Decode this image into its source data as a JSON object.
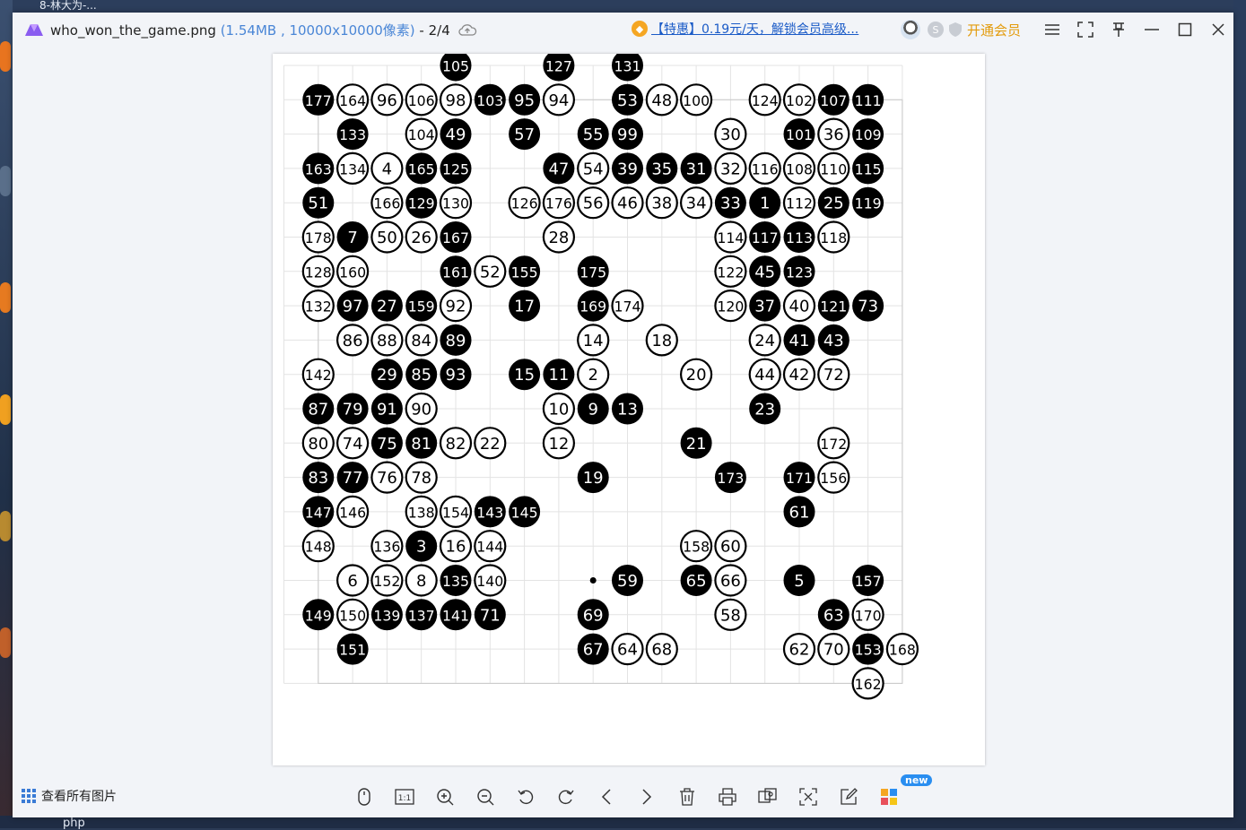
{
  "desktop": {
    "top_text": "8-林大为-...",
    "bottom_text": "php"
  },
  "window": {
    "file_name": "who_won_the_game.png",
    "file_meta": "(1.54MB , 10000x10000像素)",
    "page_index": "- 2/4",
    "promo_text": "【特惠】0.19元/天，解锁会员高级...",
    "vip_label": "开通会员",
    "icons": {
      "app": "app-logo-icon",
      "cloud": "cloud-upload-icon",
      "promo": "hexagon-badge-icon",
      "vip": "shield-icon"
    },
    "colors": {
      "link": "#4a86d6",
      "promo": "#1b5bc7",
      "vip": "#e39b0c",
      "accent_badge": "#2a8ef0"
    }
  },
  "toolbar": {
    "view_all_label": "查看所有图片",
    "new_badge": "new",
    "tools": [
      "mouse-icon",
      "actual-size-icon",
      "zoom-in-icon",
      "zoom-out-icon",
      "rotate-left-icon",
      "rotate-right-icon",
      "prev-icon",
      "next-icon",
      "delete-icon",
      "print-icon",
      "convert-icon",
      "ocr-icon",
      "edit-icon",
      "apps-icon"
    ],
    "actual_size_label": "1:1"
  },
  "board": {
    "size": 19,
    "colors": {
      "black": "#000000",
      "white": "#ffffff",
      "grid": "#e3e3e3"
    },
    "stones": [
      {
        "c": 5,
        "r": 0,
        "n": 105,
        "color": "black"
      },
      {
        "c": 8,
        "r": 0,
        "n": 127,
        "color": "black"
      },
      {
        "c": 10,
        "r": 0,
        "n": 131,
        "color": "black"
      },
      {
        "c": 1,
        "r": 1,
        "n": 177,
        "color": "black"
      },
      {
        "c": 2,
        "r": 1,
        "n": 164,
        "color": "white"
      },
      {
        "c": 3,
        "r": 1,
        "n": 96,
        "color": "white"
      },
      {
        "c": 4,
        "r": 1,
        "n": 106,
        "color": "white"
      },
      {
        "c": 5,
        "r": 1,
        "n": 98,
        "color": "white"
      },
      {
        "c": 6,
        "r": 1,
        "n": 103,
        "color": "black"
      },
      {
        "c": 7,
        "r": 1,
        "n": 95,
        "color": "black"
      },
      {
        "c": 8,
        "r": 1,
        "n": 94,
        "color": "white"
      },
      {
        "c": 10,
        "r": 1,
        "n": 53,
        "color": "black"
      },
      {
        "c": 11,
        "r": 1,
        "n": 48,
        "color": "white"
      },
      {
        "c": 12,
        "r": 1,
        "n": 100,
        "color": "white"
      },
      {
        "c": 14,
        "r": 1,
        "n": 124,
        "color": "white"
      },
      {
        "c": 15,
        "r": 1,
        "n": 102,
        "color": "white"
      },
      {
        "c": 16,
        "r": 1,
        "n": 107,
        "color": "black"
      },
      {
        "c": 17,
        "r": 1,
        "n": 111,
        "color": "black"
      },
      {
        "c": 2,
        "r": 2,
        "n": 133,
        "color": "black"
      },
      {
        "c": 4,
        "r": 2,
        "n": 104,
        "color": "white"
      },
      {
        "c": 5,
        "r": 2,
        "n": 49,
        "color": "black"
      },
      {
        "c": 7,
        "r": 2,
        "n": 57,
        "color": "black"
      },
      {
        "c": 9,
        "r": 2,
        "n": 55,
        "color": "black"
      },
      {
        "c": 10,
        "r": 2,
        "n": 99,
        "color": "black"
      },
      {
        "c": 13,
        "r": 2,
        "n": 30,
        "color": "white"
      },
      {
        "c": 15,
        "r": 2,
        "n": 101,
        "color": "black"
      },
      {
        "c": 16,
        "r": 2,
        "n": 36,
        "color": "white"
      },
      {
        "c": 17,
        "r": 2,
        "n": 109,
        "color": "black"
      },
      {
        "c": 1,
        "r": 3,
        "n": 163,
        "color": "black"
      },
      {
        "c": 2,
        "r": 3,
        "n": 134,
        "color": "white"
      },
      {
        "c": 3,
        "r": 3,
        "n": 4,
        "color": "white"
      },
      {
        "c": 4,
        "r": 3,
        "n": 165,
        "color": "black"
      },
      {
        "c": 5,
        "r": 3,
        "n": 125,
        "color": "black"
      },
      {
        "c": 8,
        "r": 3,
        "n": 47,
        "color": "black"
      },
      {
        "c": 9,
        "r": 3,
        "n": 54,
        "color": "white"
      },
      {
        "c": 10,
        "r": 3,
        "n": 39,
        "color": "black"
      },
      {
        "c": 11,
        "r": 3,
        "n": 35,
        "color": "black"
      },
      {
        "c": 12,
        "r": 3,
        "n": 31,
        "color": "black"
      },
      {
        "c": 13,
        "r": 3,
        "n": 32,
        "color": "white"
      },
      {
        "c": 14,
        "r": 3,
        "n": 116,
        "color": "white"
      },
      {
        "c": 15,
        "r": 3,
        "n": 108,
        "color": "white"
      },
      {
        "c": 16,
        "r": 3,
        "n": 110,
        "color": "white"
      },
      {
        "c": 17,
        "r": 3,
        "n": 115,
        "color": "black"
      },
      {
        "c": 1,
        "r": 4,
        "n": 51,
        "color": "black"
      },
      {
        "c": 3,
        "r": 4,
        "n": 166,
        "color": "white"
      },
      {
        "c": 4,
        "r": 4,
        "n": 129,
        "color": "black"
      },
      {
        "c": 5,
        "r": 4,
        "n": 130,
        "color": "white"
      },
      {
        "c": 7,
        "r": 4,
        "n": 126,
        "color": "white"
      },
      {
        "c": 8,
        "r": 4,
        "n": 176,
        "color": "white"
      },
      {
        "c": 9,
        "r": 4,
        "n": 56,
        "color": "white"
      },
      {
        "c": 10,
        "r": 4,
        "n": 46,
        "color": "white"
      },
      {
        "c": 11,
        "r": 4,
        "n": 38,
        "color": "white"
      },
      {
        "c": 12,
        "r": 4,
        "n": 34,
        "color": "white"
      },
      {
        "c": 13,
        "r": 4,
        "n": 33,
        "color": "black"
      },
      {
        "c": 14,
        "r": 4,
        "n": 1,
        "color": "black"
      },
      {
        "c": 15,
        "r": 4,
        "n": 112,
        "color": "white"
      },
      {
        "c": 16,
        "r": 4,
        "n": 25,
        "color": "black"
      },
      {
        "c": 17,
        "r": 4,
        "n": 119,
        "color": "black"
      },
      {
        "c": 1,
        "r": 5,
        "n": 178,
        "color": "white"
      },
      {
        "c": 2,
        "r": 5,
        "n": 7,
        "color": "black"
      },
      {
        "c": 3,
        "r": 5,
        "n": 50,
        "color": "white"
      },
      {
        "c": 4,
        "r": 5,
        "n": 26,
        "color": "white"
      },
      {
        "c": 5,
        "r": 5,
        "n": 167,
        "color": "black"
      },
      {
        "c": 8,
        "r": 5,
        "n": 28,
        "color": "white"
      },
      {
        "c": 13,
        "r": 5,
        "n": 114,
        "color": "white"
      },
      {
        "c": 14,
        "r": 5,
        "n": 117,
        "color": "black"
      },
      {
        "c": 15,
        "r": 5,
        "n": 113,
        "color": "black"
      },
      {
        "c": 16,
        "r": 5,
        "n": 118,
        "color": "white"
      },
      {
        "c": 1,
        "r": 6,
        "n": 128,
        "color": "white"
      },
      {
        "c": 2,
        "r": 6,
        "n": 160,
        "color": "white"
      },
      {
        "c": 5,
        "r": 6,
        "n": 161,
        "color": "black"
      },
      {
        "c": 6,
        "r": 6,
        "n": 52,
        "color": "white"
      },
      {
        "c": 7,
        "r": 6,
        "n": 155,
        "color": "black"
      },
      {
        "c": 9,
        "r": 6,
        "n": 175,
        "color": "black"
      },
      {
        "c": 13,
        "r": 6,
        "n": 122,
        "color": "white"
      },
      {
        "c": 14,
        "r": 6,
        "n": 45,
        "color": "black"
      },
      {
        "c": 15,
        "r": 6,
        "n": 123,
        "color": "black"
      },
      {
        "c": 1,
        "r": 7,
        "n": 132,
        "color": "white"
      },
      {
        "c": 2,
        "r": 7,
        "n": 97,
        "color": "black"
      },
      {
        "c": 3,
        "r": 7,
        "n": 27,
        "color": "black"
      },
      {
        "c": 4,
        "r": 7,
        "n": 159,
        "color": "black"
      },
      {
        "c": 5,
        "r": 7,
        "n": 92,
        "color": "white"
      },
      {
        "c": 7,
        "r": 7,
        "n": 17,
        "color": "black"
      },
      {
        "c": 9,
        "r": 7,
        "n": 169,
        "color": "black"
      },
      {
        "c": 10,
        "r": 7,
        "n": 174,
        "color": "white"
      },
      {
        "c": 13,
        "r": 7,
        "n": 120,
        "color": "white"
      },
      {
        "c": 14,
        "r": 7,
        "n": 37,
        "color": "black"
      },
      {
        "c": 15,
        "r": 7,
        "n": 40,
        "color": "white"
      },
      {
        "c": 16,
        "r": 7,
        "n": 121,
        "color": "black"
      },
      {
        "c": 17,
        "r": 7,
        "n": 73,
        "color": "black"
      },
      {
        "c": 2,
        "r": 8,
        "n": 86,
        "color": "white"
      },
      {
        "c": 3,
        "r": 8,
        "n": 88,
        "color": "white"
      },
      {
        "c": 4,
        "r": 8,
        "n": 84,
        "color": "white"
      },
      {
        "c": 5,
        "r": 8,
        "n": 89,
        "color": "black"
      },
      {
        "c": 9,
        "r": 8,
        "n": 14,
        "color": "white"
      },
      {
        "c": 11,
        "r": 8,
        "n": 18,
        "color": "white"
      },
      {
        "c": 14,
        "r": 8,
        "n": 24,
        "color": "white"
      },
      {
        "c": 15,
        "r": 8,
        "n": 41,
        "color": "black"
      },
      {
        "c": 16,
        "r": 8,
        "n": 43,
        "color": "black"
      },
      {
        "c": 1,
        "r": 9,
        "n": 142,
        "color": "white"
      },
      {
        "c": 3,
        "r": 9,
        "n": 29,
        "color": "black"
      },
      {
        "c": 4,
        "r": 9,
        "n": 85,
        "color": "black"
      },
      {
        "c": 5,
        "r": 9,
        "n": 93,
        "color": "black"
      },
      {
        "c": 7,
        "r": 9,
        "n": 15,
        "color": "black"
      },
      {
        "c": 8,
        "r": 9,
        "n": 11,
        "color": "black"
      },
      {
        "c": 9,
        "r": 9,
        "n": 2,
        "color": "white"
      },
      {
        "c": 12,
        "r": 9,
        "n": 20,
        "color": "white"
      },
      {
        "c": 14,
        "r": 9,
        "n": 44,
        "color": "white"
      },
      {
        "c": 15,
        "r": 9,
        "n": 42,
        "color": "white"
      },
      {
        "c": 16,
        "r": 9,
        "n": 72,
        "color": "white"
      },
      {
        "c": 1,
        "r": 10,
        "n": 87,
        "color": "black"
      },
      {
        "c": 2,
        "r": 10,
        "n": 79,
        "color": "black"
      },
      {
        "c": 3,
        "r": 10,
        "n": 91,
        "color": "black"
      },
      {
        "c": 4,
        "r": 10,
        "n": 90,
        "color": "white"
      },
      {
        "c": 8,
        "r": 10,
        "n": 10,
        "color": "white"
      },
      {
        "c": 9,
        "r": 10,
        "n": 9,
        "color": "black"
      },
      {
        "c": 10,
        "r": 10,
        "n": 13,
        "color": "black"
      },
      {
        "c": 14,
        "r": 10,
        "n": 23,
        "color": "black"
      },
      {
        "c": 1,
        "r": 11,
        "n": 80,
        "color": "white"
      },
      {
        "c": 2,
        "r": 11,
        "n": 74,
        "color": "white"
      },
      {
        "c": 3,
        "r": 11,
        "n": 75,
        "color": "black"
      },
      {
        "c": 4,
        "r": 11,
        "n": 81,
        "color": "black"
      },
      {
        "c": 5,
        "r": 11,
        "n": 82,
        "color": "white"
      },
      {
        "c": 6,
        "r": 11,
        "n": 22,
        "color": "white"
      },
      {
        "c": 8,
        "r": 11,
        "n": 12,
        "color": "white"
      },
      {
        "c": 12,
        "r": 11,
        "n": 21,
        "color": "black"
      },
      {
        "c": 16,
        "r": 11,
        "n": 172,
        "color": "white"
      },
      {
        "c": 1,
        "r": 12,
        "n": 83,
        "color": "black"
      },
      {
        "c": 2,
        "r": 12,
        "n": 77,
        "color": "black"
      },
      {
        "c": 3,
        "r": 12,
        "n": 76,
        "color": "white"
      },
      {
        "c": 4,
        "r": 12,
        "n": 78,
        "color": "white"
      },
      {
        "c": 9,
        "r": 12,
        "n": 19,
        "color": "black"
      },
      {
        "c": 13,
        "r": 12,
        "n": 173,
        "color": "black"
      },
      {
        "c": 15,
        "r": 12,
        "n": 171,
        "color": "black"
      },
      {
        "c": 16,
        "r": 12,
        "n": 156,
        "color": "white"
      },
      {
        "c": 1,
        "r": 13,
        "n": 147,
        "color": "black"
      },
      {
        "c": 2,
        "r": 13,
        "n": 146,
        "color": "white"
      },
      {
        "c": 4,
        "r": 13,
        "n": 138,
        "color": "white"
      },
      {
        "c": 5,
        "r": 13,
        "n": 154,
        "color": "white"
      },
      {
        "c": 6,
        "r": 13,
        "n": 143,
        "color": "black"
      },
      {
        "c": 7,
        "r": 13,
        "n": 145,
        "color": "black"
      },
      {
        "c": 15,
        "r": 13,
        "n": 61,
        "color": "black"
      },
      {
        "c": 1,
        "r": 14,
        "n": 148,
        "color": "white"
      },
      {
        "c": 3,
        "r": 14,
        "n": 136,
        "color": "white"
      },
      {
        "c": 4,
        "r": 14,
        "n": 3,
        "color": "black"
      },
      {
        "c": 5,
        "r": 14,
        "n": 16,
        "color": "white"
      },
      {
        "c": 6,
        "r": 14,
        "n": 144,
        "color": "white"
      },
      {
        "c": 12,
        "r": 14,
        "n": 158,
        "color": "white"
      },
      {
        "c": 13,
        "r": 14,
        "n": 60,
        "color": "white"
      },
      {
        "c": 2,
        "r": 15,
        "n": 6,
        "color": "white"
      },
      {
        "c": 3,
        "r": 15,
        "n": 152,
        "color": "white"
      },
      {
        "c": 4,
        "r": 15,
        "n": 8,
        "color": "white"
      },
      {
        "c": 5,
        "r": 15,
        "n": 135,
        "color": "black"
      },
      {
        "c": 6,
        "r": 15,
        "n": 140,
        "color": "white"
      },
      {
        "c": 10,
        "r": 15,
        "n": 59,
        "color": "black"
      },
      {
        "c": 12,
        "r": 15,
        "n": 65,
        "color": "black"
      },
      {
        "c": 13,
        "r": 15,
        "n": 66,
        "color": "white"
      },
      {
        "c": 15,
        "r": 15,
        "n": 5,
        "color": "black"
      },
      {
        "c": 17,
        "r": 15,
        "n": 157,
        "color": "black"
      },
      {
        "c": 1,
        "r": 16,
        "n": 149,
        "color": "black"
      },
      {
        "c": 2,
        "r": 16,
        "n": 150,
        "color": "white"
      },
      {
        "c": 3,
        "r": 16,
        "n": 139,
        "color": "black"
      },
      {
        "c": 4,
        "r": 16,
        "n": 137,
        "color": "black"
      },
      {
        "c": 5,
        "r": 16,
        "n": 141,
        "color": "black"
      },
      {
        "c": 6,
        "r": 16,
        "n": 71,
        "color": "black"
      },
      {
        "c": 9,
        "r": 16,
        "n": 69,
        "color": "black"
      },
      {
        "c": 13,
        "r": 16,
        "n": 58,
        "color": "white"
      },
      {
        "c": 16,
        "r": 16,
        "n": 63,
        "color": "black"
      },
      {
        "c": 17,
        "r": 16,
        "n": 170,
        "color": "white"
      },
      {
        "c": 2,
        "r": 17,
        "n": 151,
        "color": "black"
      },
      {
        "c": 9,
        "r": 17,
        "n": 67,
        "color": "black"
      },
      {
        "c": 10,
        "r": 17,
        "n": 64,
        "color": "white"
      },
      {
        "c": 11,
        "r": 17,
        "n": 68,
        "color": "white"
      },
      {
        "c": 15,
        "r": 17,
        "n": 62,
        "color": "white"
      },
      {
        "c": 16,
        "r": 17,
        "n": 70,
        "color": "white"
      },
      {
        "c": 17,
        "r": 17,
        "n": 153,
        "color": "black"
      },
      {
        "c": 18,
        "r": 17,
        "n": 168,
        "color": "white"
      },
      {
        "c": 17,
        "r": 18,
        "n": 162,
        "color": "white"
      }
    ],
    "markers": [
      {
        "c": 9,
        "r": 15
      }
    ]
  }
}
